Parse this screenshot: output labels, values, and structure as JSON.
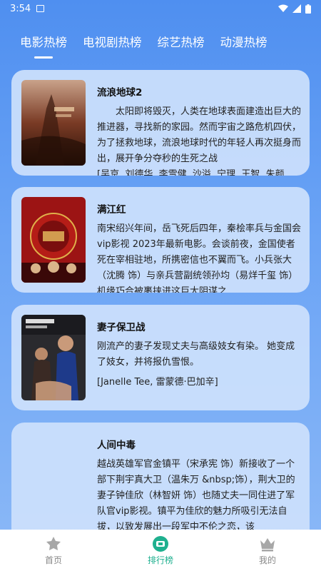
{
  "status_bar": {
    "time": "3:54"
  },
  "tabs": [
    {
      "label": "电影热榜"
    },
    {
      "label": "电视剧热榜"
    },
    {
      "label": "综艺热榜"
    },
    {
      "label": "动漫热榜"
    }
  ],
  "cards": [
    {
      "title": "流浪地球2",
      "description": "　　太阳即将毁灭，人类在地球表面建造出巨大的推进器，寻找新的家园。然而宇宙之路危机四伏，为了拯救地球，流浪地球时代的年轻人再次挺身而出，展开争分夺秒的生死之战",
      "cast": "[吴京, 刘德华, 李雪健, 沙溢, 宁理, 王智, 朱颜"
    },
    {
      "title": "满江红",
      "description": "南宋绍兴年间，岳飞死后四年，秦桧率兵与金国会vip影视 2023年最新电影。会谈前夜，金国使者死在宰相驻地，所携密信也不翼而飞。小兵张大（沈腾 饰）与亲兵营副统领孙均（易烊千玺 饰）机缘巧合被裹挟进这巨大阴谋之"
    },
    {
      "title": "妻子保卫战",
      "description": "刚流产的妻子发现丈夫与高级妓女有染。 她变成了妓女，并将报仇雪恨。",
      "cast": "[Janelle Tee, 雷蒙德·巴加辛]"
    },
    {
      "title": "人间中毒",
      "description": "越战英雄军官金镇平（宋承宪 饰）新接收了一个部下荆宇真大卫（温朱万 &nbsp;饰），荆大卫的妻子钟佳欣（林智妍 饰）也随丈夫一同住进了军队官vip影视。镇平为佳欣的魅力所吸引无法自拔，以致发展出一段军中不伦之恋，该"
    }
  ],
  "bottom_nav": [
    {
      "label": "首页"
    },
    {
      "label": "排行榜"
    },
    {
      "label": "我的"
    }
  ],
  "colors": {
    "accent": "#1fb08f",
    "background": "#5b98f2"
  }
}
